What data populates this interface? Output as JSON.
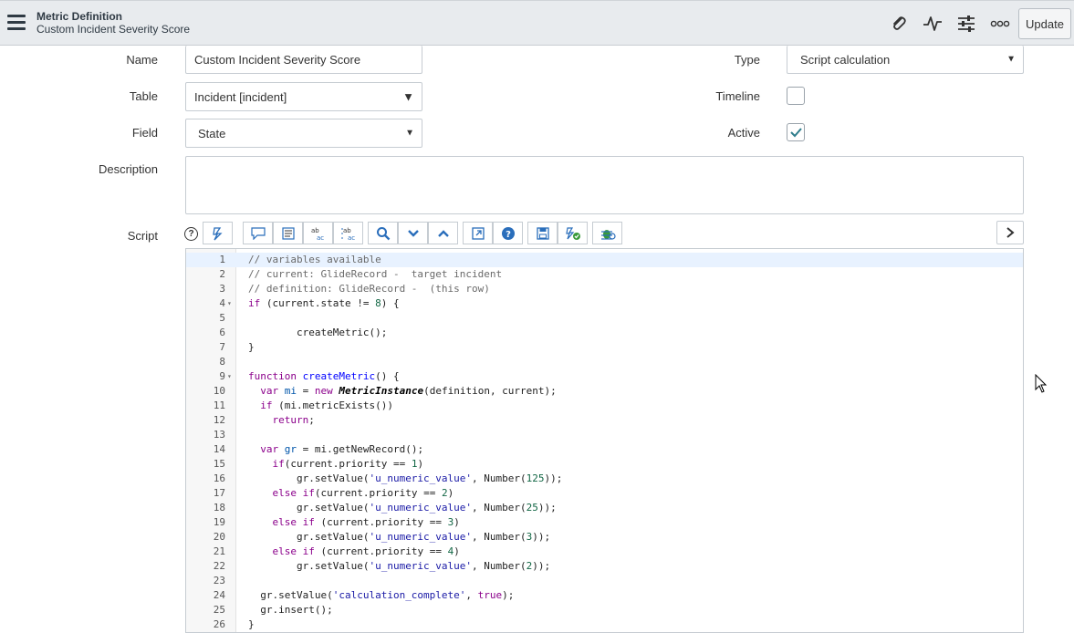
{
  "header": {
    "title": "Metric Definition",
    "subtitle": "Custom Incident Severity Score",
    "update_label": "Update",
    "icons": [
      "paperclip-icon",
      "activity-icon",
      "settings-sliders-icon",
      "more-icon"
    ]
  },
  "form": {
    "name_label": "Name",
    "name_value": "Custom Incident Severity Score",
    "table_label": "Table",
    "table_value": "Incident [incident]",
    "field_label": "Field",
    "field_value": "State",
    "description_label": "Description",
    "description_value": "",
    "type_label": "Type",
    "type_value": "Script calculation",
    "timeline_label": "Timeline",
    "timeline_checked": false,
    "active_label": "Active",
    "active_checked": true,
    "script_label": "Script"
  },
  "colors": {
    "header_bg": "#e8ebee",
    "toolbar_icon": "#2a6ebb",
    "check": "#2e7d8c"
  },
  "script": {
    "lines": [
      "// variables available",
      "// current: GlideRecord -  target incident",
      "// definition: GlideRecord -  (this row)",
      "if (current.state != 8) {",
      "",
      "        createMetric();",
      "}",
      "",
      "function createMetric() {",
      "  var mi = new MetricInstance(definition, current);",
      "  if (mi.metricExists())",
      "    return;",
      "",
      "  var gr = mi.getNewRecord();",
      "    if(current.priority == 1)",
      "        gr.setValue('u_numeric_value', Number(125));",
      "    else if(current.priority == 2)",
      "        gr.setValue('u_numeric_value', Number(25));",
      "    else if (current.priority == 3)",
      "        gr.setValue('u_numeric_value', Number(3));",
      "    else if (current.priority == 4)",
      "        gr.setValue('u_numeric_value', Number(2));",
      "",
      "  gr.setValue('calculation_complete', true);",
      "  gr.insert();",
      "}"
    ],
    "fold_lines": [
      4,
      9
    ]
  }
}
